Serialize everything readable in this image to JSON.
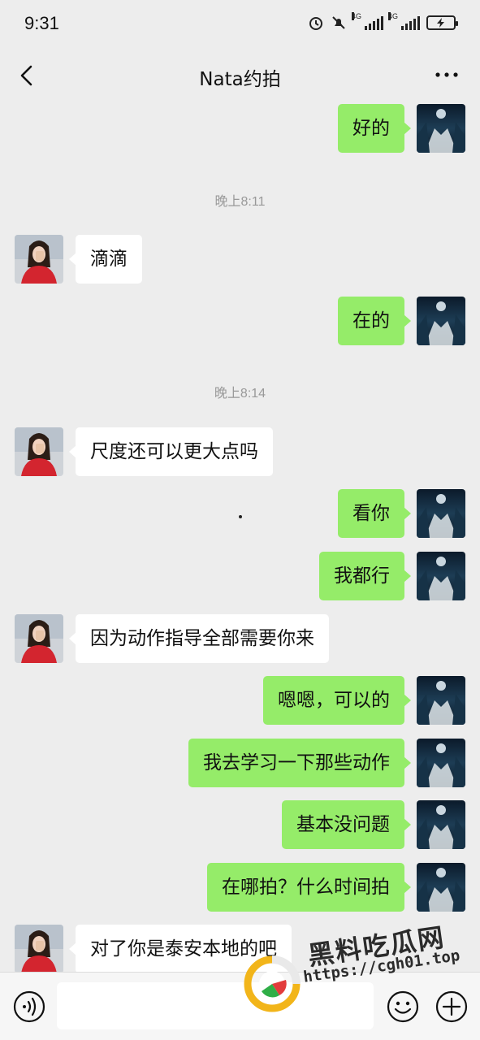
{
  "status_bar": {
    "time": "9:31",
    "battery": "100"
  },
  "header": {
    "title": "Nata约拍"
  },
  "messages": [
    {
      "side": "right",
      "text": "好的"
    },
    {
      "side": "center",
      "timestamp": "晚上8:11"
    },
    {
      "side": "left",
      "text": "滴滴"
    },
    {
      "side": "right",
      "text": "在的"
    },
    {
      "side": "center",
      "timestamp": "晚上8:14"
    },
    {
      "side": "left",
      "text": "尺度还可以更大点吗"
    },
    {
      "side": "right",
      "text": "看你"
    },
    {
      "side": "right",
      "text": "我都行"
    },
    {
      "side": "left",
      "text": "因为动作指导全部需要你来"
    },
    {
      "side": "right",
      "text": "嗯嗯，可以的"
    },
    {
      "side": "right",
      "text": "我去学习一下那些动作"
    },
    {
      "side": "right",
      "text": "基本没问题"
    },
    {
      "side": "right",
      "text": "在哪拍？什么时间拍"
    },
    {
      "side": "left",
      "text": "对了你是泰安本地的吧"
    }
  ],
  "input": {
    "placeholder": ""
  },
  "watermark": {
    "brand": "黑料吃瓜网",
    "url": "https://cgh01.top"
  },
  "colors": {
    "background": "#ededed",
    "sent_bubble": "#95ec69",
    "received_bubble": "#ffffff",
    "timestamp": "#999999"
  }
}
